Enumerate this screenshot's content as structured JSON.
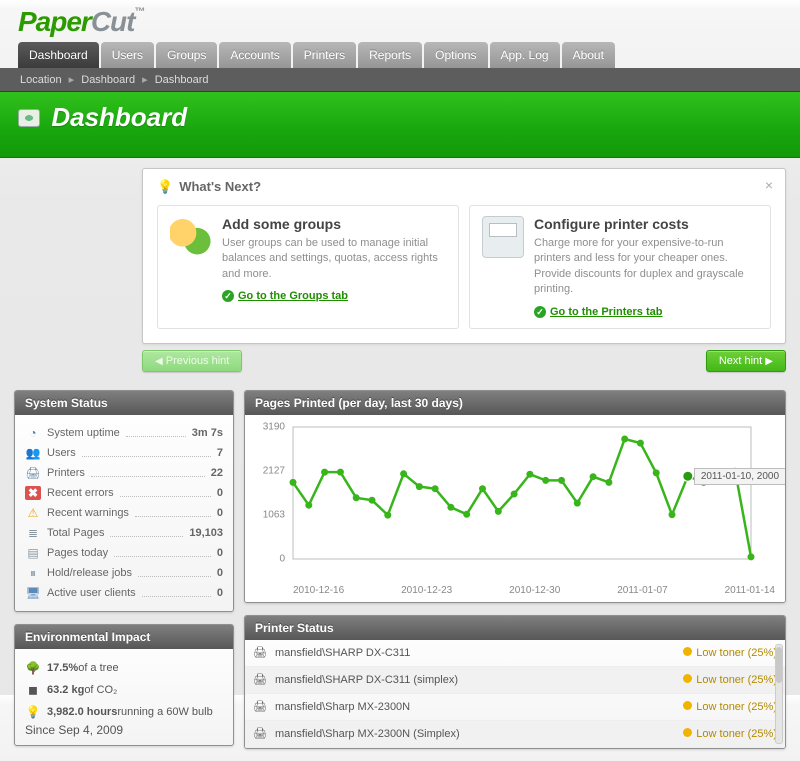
{
  "logo": {
    "part1": "Paper",
    "part2": "Cut",
    "tm": "™"
  },
  "tabs": [
    "Dashboard",
    "Users",
    "Groups",
    "Accounts",
    "Printers",
    "Reports",
    "Options",
    "App. Log",
    "About"
  ],
  "active_tab": 0,
  "breadcrumb": {
    "label": "Location",
    "items": [
      "Dashboard",
      "Dashboard"
    ]
  },
  "hero_title": "Dashboard",
  "whats_next": {
    "title": "What's Next?",
    "cards": [
      {
        "title": "Add some groups",
        "body": "User groups can be used to manage initial balances and settings, quotas, access rights and more.",
        "link": "Go to the Groups tab"
      },
      {
        "title": "Configure printer costs",
        "body": "Charge more for your expensive-to-run printers and less for your cheaper ones. Provide discounts for duplex and grayscale printing.",
        "link": "Go to the Printers tab"
      }
    ],
    "prev": "Previous hint",
    "next": "Next hint"
  },
  "system_status": {
    "title": "System Status",
    "rows": [
      {
        "icon": "clock",
        "label": "System uptime",
        "value": "3m 7s"
      },
      {
        "icon": "users",
        "label": "Users",
        "value": "7"
      },
      {
        "icon": "printer",
        "label": "Printers",
        "value": "22"
      },
      {
        "icon": "err",
        "label": "Recent errors",
        "value": "0"
      },
      {
        "icon": "warn",
        "label": "Recent warnings",
        "value": "0"
      },
      {
        "icon": "pages",
        "label": "Total Pages",
        "value": "19,103"
      },
      {
        "icon": "today",
        "label": "Pages today",
        "value": "0"
      },
      {
        "icon": "hold",
        "label": "Hold/release jobs",
        "value": "0"
      },
      {
        "icon": "clients",
        "label": "Active user clients",
        "value": "0"
      }
    ]
  },
  "env": {
    "title": "Environmental Impact",
    "rows": [
      {
        "icon": "tree",
        "strong": "17.5%",
        "rest": " of a tree"
      },
      {
        "icon": "co2",
        "strong": "63.2 kg",
        "rest": " of CO₂"
      },
      {
        "icon": "bulb",
        "strong": "3,982.0 hours",
        "rest": " running a 60W bulb"
      }
    ],
    "since": "Since Sep 4, 2009"
  },
  "chart": {
    "title": "Pages Printed (per day, last 30 days)",
    "tooltip": "2011-01-10, 2000"
  },
  "chart_data": {
    "type": "line",
    "title": "Pages Printed (per day, last 30 days)",
    "xlabel": "",
    "ylabel": "",
    "ylim": [
      0,
      3190
    ],
    "y_ticks": [
      0,
      1063,
      2127,
      3190
    ],
    "x_ticks": [
      "2010-12-16",
      "2010-12-23",
      "2010-12-30",
      "2011-01-07",
      "2011-01-14"
    ],
    "x": [
      "2010-12-16",
      "2010-12-17",
      "2010-12-18",
      "2010-12-19",
      "2010-12-20",
      "2010-12-21",
      "2010-12-22",
      "2010-12-23",
      "2010-12-24",
      "2010-12-25",
      "2010-12-26",
      "2010-12-27",
      "2010-12-28",
      "2010-12-29",
      "2010-12-30",
      "2010-12-31",
      "2011-01-01",
      "2011-01-02",
      "2011-01-03",
      "2011-01-04",
      "2011-01-05",
      "2011-01-06",
      "2011-01-07",
      "2011-01-08",
      "2011-01-09",
      "2011-01-10",
      "2011-01-11",
      "2011-01-12",
      "2011-01-13",
      "2011-01-14"
    ],
    "values": [
      1850,
      1300,
      2100,
      2100,
      1480,
      1420,
      1060,
      2060,
      1750,
      1700,
      1250,
      1080,
      1700,
      1150,
      1570,
      2050,
      1900,
      1900,
      1350,
      1990,
      1850,
      2900,
      2800,
      2080,
      1070,
      2000,
      1850,
      2100,
      2120,
      50
    ],
    "highlight": {
      "index": 25,
      "label": "2011-01-10, 2000"
    }
  },
  "printer_status": {
    "title": "Printer Status",
    "rows": [
      {
        "name": "mansfield\\SHARP DX-C311",
        "status": "Low toner (25%)"
      },
      {
        "name": "mansfield\\SHARP DX-C311 (simplex)",
        "status": "Low toner (25%)"
      },
      {
        "name": "mansfield\\Sharp MX-2300N",
        "status": "Low toner (25%)"
      },
      {
        "name": "mansfield\\Sharp MX-2300N (Simplex)",
        "status": "Low toner (25%)"
      }
    ]
  }
}
